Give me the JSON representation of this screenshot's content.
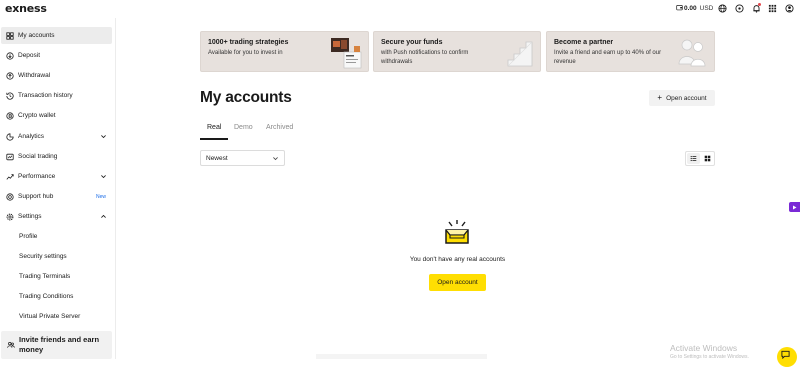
{
  "app": {
    "logo": "exness"
  },
  "topbar": {
    "balance_amount": "0.00",
    "balance_currency": "USD",
    "icons": [
      "wallet-icon",
      "globe-icon",
      "help-icon",
      "bell-icon",
      "apps-grid-icon",
      "profile-icon"
    ]
  },
  "sidebar": {
    "items": [
      {
        "label": "My accounts",
        "icon": "accounts-grid-icon",
        "active": true
      },
      {
        "label": "Deposit",
        "icon": "deposit-icon"
      },
      {
        "label": "Withdrawal",
        "icon": "withdrawal-icon"
      },
      {
        "label": "Transaction history",
        "icon": "history-icon"
      },
      {
        "label": "Crypto wallet",
        "icon": "crypto-wallet-icon"
      },
      {
        "label": "Analytics",
        "icon": "analytics-icon",
        "expandable": true
      },
      {
        "label": "Social trading",
        "icon": "social-trading-icon"
      },
      {
        "label": "Performance",
        "icon": "performance-icon",
        "expandable": true
      },
      {
        "label": "Support hub",
        "icon": "support-icon",
        "badge": "New"
      },
      {
        "label": "Settings",
        "icon": "settings-icon",
        "expanded": true
      }
    ],
    "settings_subitems": [
      "Profile",
      "Security settings",
      "Trading Terminals",
      "Trading Conditions",
      "Virtual Private Server"
    ],
    "invite": {
      "label": "Invite friends and earn money",
      "icon": "invite-icon"
    }
  },
  "promos": [
    {
      "title": "1000+ trading strategies",
      "text": "Available for you to invest in"
    },
    {
      "title": "Secure your funds",
      "text": "with Push notifications to confirm withdrawals"
    },
    {
      "title": "Become a partner",
      "text": "Invite a friend and earn up to 40% of our revenue"
    }
  ],
  "main": {
    "title": "My accounts",
    "open_account_top": "Open account",
    "tabs": [
      {
        "label": "Real",
        "active": true
      },
      {
        "label": "Demo"
      },
      {
        "label": "Archived"
      }
    ],
    "sort": {
      "value": "Newest"
    },
    "view_mode": "list",
    "empty_text": "You don't have any real accounts",
    "open_account_main": "Open account"
  },
  "overlay": {
    "activate_title": "Activate Windows",
    "activate_sub": "Go to Settings to activate Windows."
  },
  "colors": {
    "accent_yellow": "#ffde02",
    "promo_bg": "#e7e1dd",
    "active_nav_bg": "#ececec",
    "badge_blue": "#1d6ee8",
    "side_tab_purple": "#7a2ad6"
  }
}
